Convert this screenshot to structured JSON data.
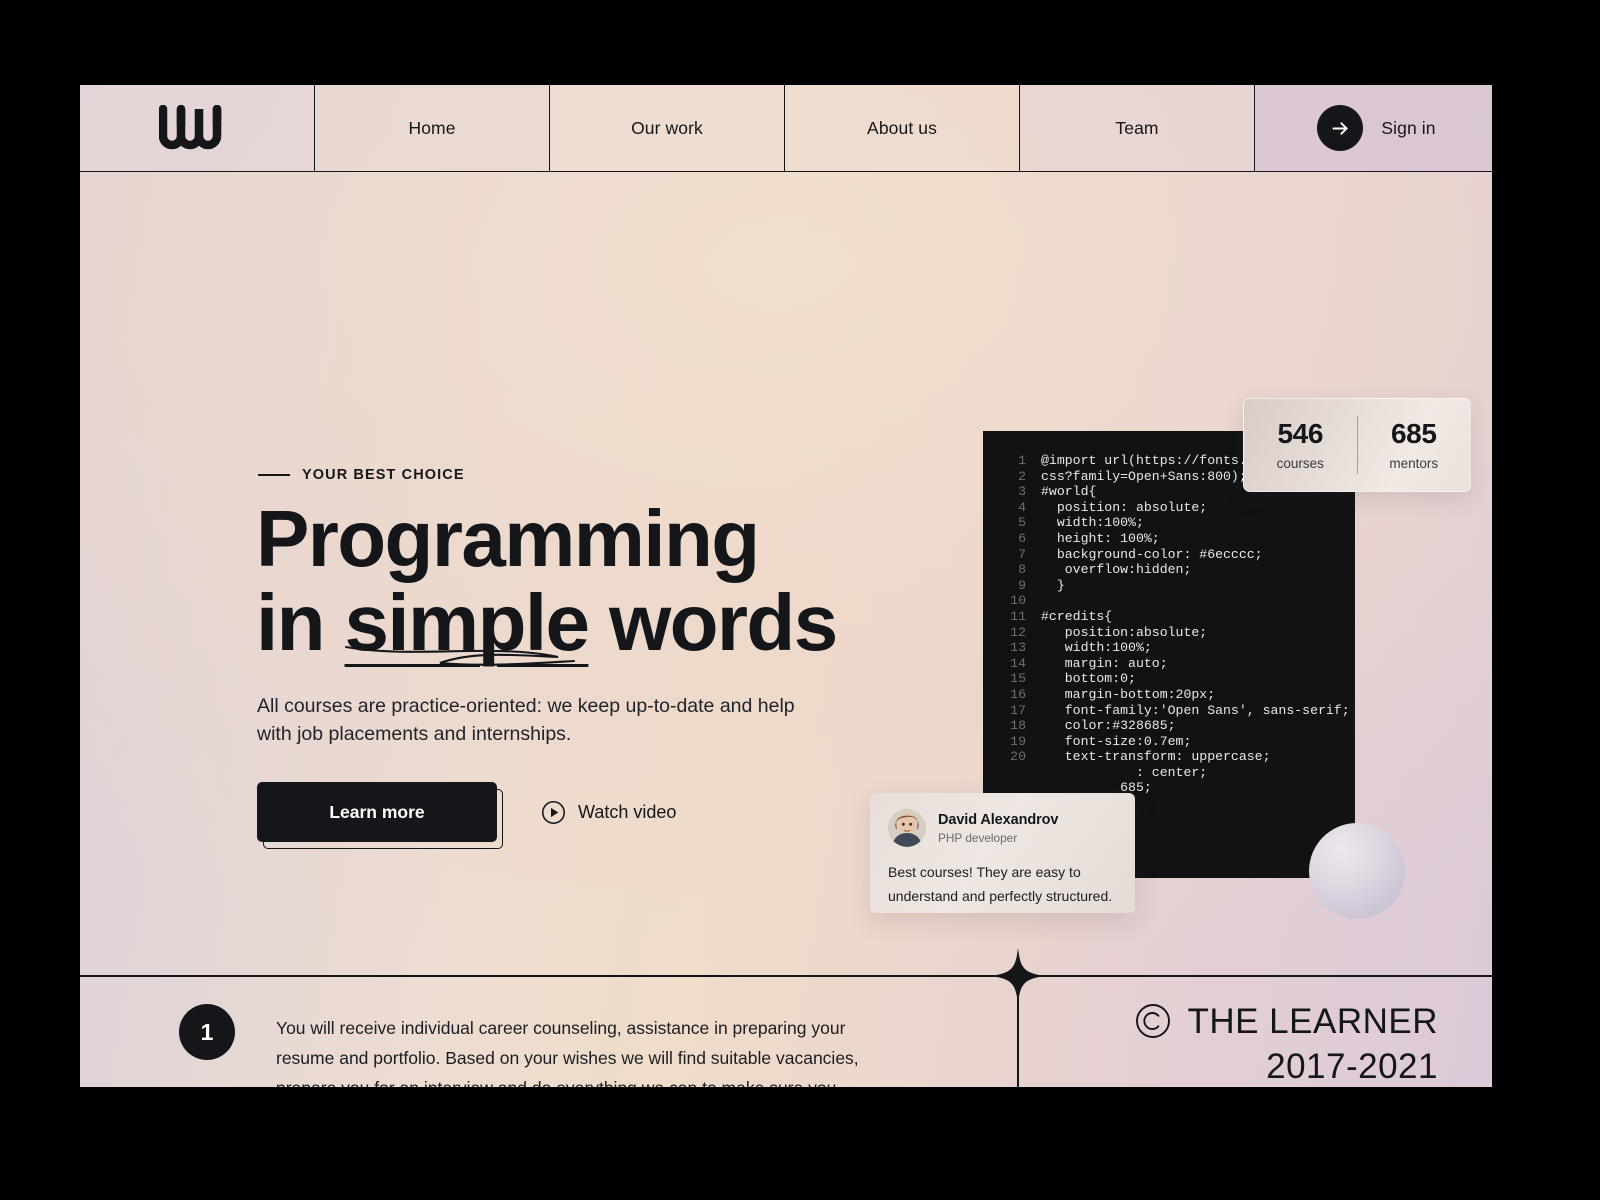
{
  "theme": {
    "ink": "#15161a",
    "code_bg": "#121214",
    "nav_signin_bg": "#d6c3d4"
  },
  "nav": {
    "logo_name": "wavy-w-logo",
    "items": [
      {
        "label": "Home",
        "name": "nav-item-home"
      },
      {
        "label": "Our work",
        "name": "nav-item-our-work"
      },
      {
        "label": "About us",
        "name": "nav-item-about-us"
      },
      {
        "label": "Team",
        "name": "nav-item-team"
      }
    ],
    "signin_label": "Sign in",
    "signin_icon": "arrow-right-icon"
  },
  "hero": {
    "eyebrow": "YOUR BEST CHOICE",
    "headline_line1": "Programming",
    "headline_line2_pre": "in ",
    "headline_line2_emphasis": "simple",
    "headline_line2_post": " words",
    "subtext": "All courses are practice-oriented: we keep up-to-date and help with job placements and internships.",
    "primary_cta": "Learn more",
    "secondary_cta": "Watch video",
    "secondary_cta_icon": "play-circle-icon"
  },
  "stats": {
    "items": [
      {
        "value": "546",
        "label": "courses"
      },
      {
        "value": "685",
        "label": "mentors"
      }
    ]
  },
  "code": {
    "lines": [
      {
        "n": "1",
        "text": "@import url(https://fonts.g"
      },
      {
        "n": "2",
        "text": "css?family=Open+Sans:800);"
      },
      {
        "n": "",
        "text": ""
      },
      {
        "n": "3",
        "text": "#world{"
      },
      {
        "n": "4",
        "text": "  position: absolute;"
      },
      {
        "n": "5",
        "text": "  width:100%;"
      },
      {
        "n": "6",
        "text": "  height: 100%;"
      },
      {
        "n": "7",
        "text": "  background-color: #6ecccc;"
      },
      {
        "n": "8",
        "text": "   overflow:hidden;"
      },
      {
        "n": "9",
        "text": "  }"
      },
      {
        "n": "10",
        "text": ""
      },
      {
        "n": "11",
        "text": "#credits{"
      },
      {
        "n": "12",
        "text": "   position:absolute;"
      },
      {
        "n": "13",
        "text": "   width:100%;"
      },
      {
        "n": "14",
        "text": "   margin: auto;"
      },
      {
        "n": "15",
        "text": "   bottom:0;"
      },
      {
        "n": "16",
        "text": "   margin-bottom:20px;"
      },
      {
        "n": "17",
        "text": "   font-family:'Open Sans', sans-serif;"
      },
      {
        "n": "18",
        "text": "   color:#328685;"
      },
      {
        "n": "19",
        "text": "   font-size:0.7em;"
      },
      {
        "n": "20",
        "text": "   text-transform: uppercase;"
      },
      {
        "n": "",
        "text": "            : center;"
      },
      {
        "n": "",
        "text": ""
      },
      {
        "n": "",
        "text": ""
      },
      {
        "n": "",
        "text": "          685;"
      }
    ]
  },
  "testimonial": {
    "avatar_name": "avatar-david-alexandrov",
    "name": "David Alexandrov",
    "role": "PHP developer",
    "quote": "Best courses! They are easy to understand and perfectly structured."
  },
  "footer": {
    "step_number": "1",
    "text": "You will receive individual career counseling, assistance in preparing your resume and portfolio. Based on your wishes we will find suitable vacancies, prepare you for an interview and do everything we can to make sure you",
    "copyright_icon": "copyright-icon",
    "brand": "THE LEARNER",
    "years": "2017-2021",
    "sparkle_icon": "four-point-star-icon"
  }
}
